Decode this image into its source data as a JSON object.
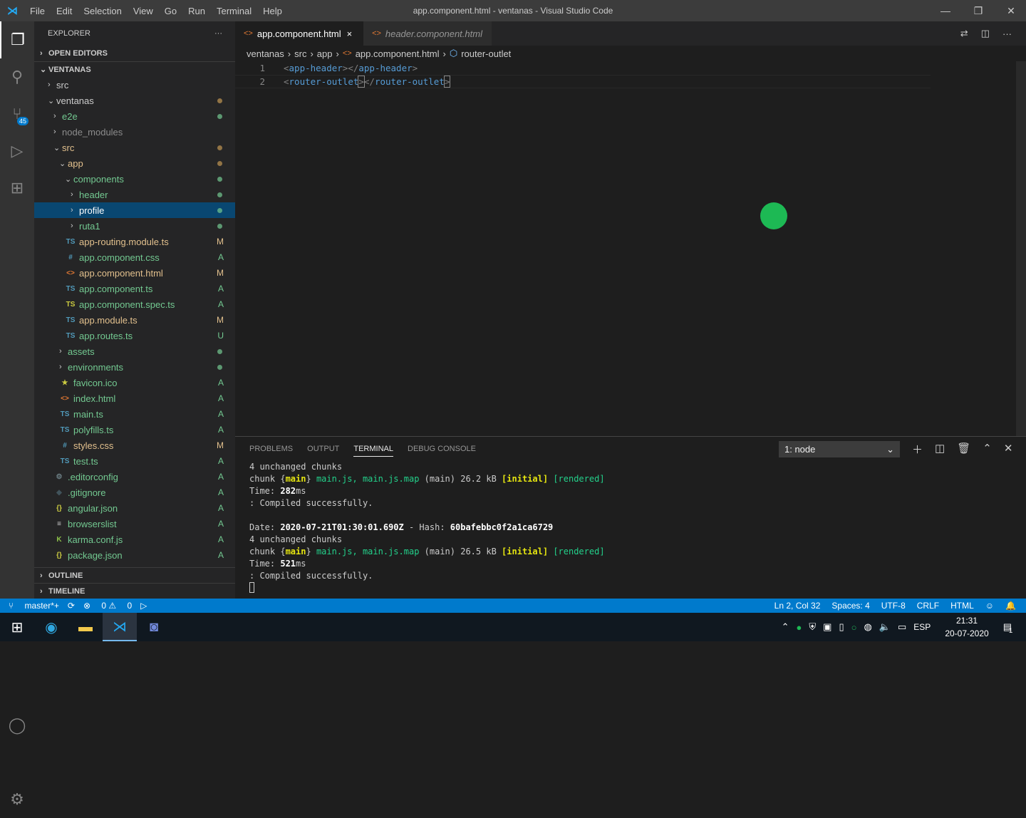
{
  "title_bar": {
    "menu": [
      "File",
      "Edit",
      "Selection",
      "View",
      "Go",
      "Run",
      "Terminal",
      "Help"
    ],
    "title": "app.component.html - ventanas - Visual Studio Code"
  },
  "activity": {
    "scm_badge": "45"
  },
  "sidebar": {
    "title": "EXPLORER",
    "more": "···",
    "open_editors": "OPEN EDITORS",
    "workspace": "VENTANAS",
    "outline": "OUTLINE",
    "timeline": "TIMELINE",
    "tree": [
      {
        "label": "src",
        "indent": 0,
        "type": "closed",
        "color": "#cccccc"
      },
      {
        "label": "ventanas",
        "indent": 0,
        "type": "open",
        "color": "#cccccc",
        "dot": "#c09553"
      },
      {
        "label": "e2e",
        "indent": 1,
        "type": "closed",
        "color": "#73c991",
        "dot": "#73c991"
      },
      {
        "label": "node_modules",
        "indent": 1,
        "type": "closed",
        "color": "#8c8c8c"
      },
      {
        "label": "src",
        "indent": 1,
        "type": "open",
        "color": "#e2c08d",
        "dot": "#c09553"
      },
      {
        "label": "app",
        "indent": 2,
        "type": "open",
        "color": "#e2c08d",
        "dot": "#c09553"
      },
      {
        "label": "components",
        "indent": 3,
        "type": "open",
        "color": "#73c991",
        "dot": "#73c991"
      },
      {
        "label": "header",
        "indent": 4,
        "type": "closed",
        "color": "#73c991",
        "dot": "#73c991"
      },
      {
        "label": "profile",
        "indent": 4,
        "type": "closed",
        "color": "#ffffff",
        "dot": "#73c991",
        "selected": true
      },
      {
        "label": "ruta1",
        "indent": 4,
        "type": "closed",
        "color": "#73c991",
        "dot": "#73c991"
      },
      {
        "label": "app-routing.module.ts",
        "indent": 3,
        "type": "file",
        "icon": "TS",
        "icolor": "#519aba",
        "color": "#e2c08d",
        "deco": "M"
      },
      {
        "label": "app.component.css",
        "indent": 3,
        "type": "file",
        "icon": "#",
        "icolor": "#519aba",
        "color": "#73c991",
        "deco": "A"
      },
      {
        "label": "app.component.html",
        "indent": 3,
        "type": "file",
        "icon": "<>",
        "icolor": "#e37933",
        "color": "#e2c08d",
        "deco": "M"
      },
      {
        "label": "app.component.ts",
        "indent": 3,
        "type": "file",
        "icon": "TS",
        "icolor": "#519aba",
        "color": "#73c991",
        "deco": "A"
      },
      {
        "label": "app.component.spec.ts",
        "indent": 3,
        "type": "file",
        "icon": "TS",
        "icolor": "#cbcb41",
        "color": "#73c991",
        "deco": "A"
      },
      {
        "label": "app.module.ts",
        "indent": 3,
        "type": "file",
        "icon": "TS",
        "icolor": "#519aba",
        "color": "#e2c08d",
        "deco": "M"
      },
      {
        "label": "app.routes.ts",
        "indent": 3,
        "type": "file",
        "icon": "TS",
        "icolor": "#519aba",
        "color": "#73c991",
        "deco": "U"
      },
      {
        "label": "assets",
        "indent": 2,
        "type": "closed",
        "color": "#73c991",
        "dot": "#73c991"
      },
      {
        "label": "environments",
        "indent": 2,
        "type": "closed",
        "color": "#73c991",
        "dot": "#73c991"
      },
      {
        "label": "favicon.ico",
        "indent": 2,
        "type": "file",
        "icon": "★",
        "icolor": "#cbcb41",
        "color": "#73c991",
        "deco": "A"
      },
      {
        "label": "index.html",
        "indent": 2,
        "type": "file",
        "icon": "<>",
        "icolor": "#e37933",
        "color": "#73c991",
        "deco": "A"
      },
      {
        "label": "main.ts",
        "indent": 2,
        "type": "file",
        "icon": "TS",
        "icolor": "#519aba",
        "color": "#73c991",
        "deco": "A"
      },
      {
        "label": "polyfills.ts",
        "indent": 2,
        "type": "file",
        "icon": "TS",
        "icolor": "#519aba",
        "color": "#73c991",
        "deco": "A"
      },
      {
        "label": "styles.css",
        "indent": 2,
        "type": "file",
        "icon": "#",
        "icolor": "#519aba",
        "color": "#e2c08d",
        "deco": "M"
      },
      {
        "label": "test.ts",
        "indent": 2,
        "type": "file",
        "icon": "TS",
        "icolor": "#519aba",
        "color": "#73c991",
        "deco": "A"
      },
      {
        "label": ".editorconfig",
        "indent": 1,
        "type": "file",
        "icon": "⚙",
        "icolor": "#6d8086",
        "color": "#73c991",
        "deco": "A"
      },
      {
        "label": ".gitignore",
        "indent": 1,
        "type": "file",
        "icon": "◆",
        "icolor": "#41535b",
        "color": "#73c991",
        "deco": "A"
      },
      {
        "label": "angular.json",
        "indent": 1,
        "type": "file",
        "icon": "{}",
        "icolor": "#cbcb41",
        "color": "#73c991",
        "deco": "A"
      },
      {
        "label": "browserslist",
        "indent": 1,
        "type": "file",
        "icon": "≡",
        "icolor": "#cccccc",
        "color": "#73c991",
        "deco": "A"
      },
      {
        "label": "karma.conf.js",
        "indent": 1,
        "type": "file",
        "icon": "K",
        "icolor": "#8dc149",
        "color": "#73c991",
        "deco": "A"
      },
      {
        "label": "package.json",
        "indent": 1,
        "type": "file",
        "icon": "{}",
        "icolor": "#cbcb41",
        "color": "#73c991",
        "deco": "A"
      }
    ]
  },
  "tabs": [
    {
      "label": "app.component.html",
      "active": true,
      "close": "×"
    },
    {
      "label": "header.component.html",
      "active": false
    }
  ],
  "breadcrumb": [
    "ventanas",
    "src",
    "app",
    "app.component.html",
    "router-outlet"
  ],
  "code": {
    "lines": [
      {
        "n": "1",
        "open": "app-header",
        "close": "app-header"
      },
      {
        "n": "2",
        "open": "router-outlet",
        "close": "router-outlet"
      }
    ]
  },
  "panel": {
    "tabs": [
      "PROBLEMS",
      "OUTPUT",
      "TERMINAL",
      "DEBUG CONSOLE"
    ],
    "active_tab": "TERMINAL",
    "terminal_select": "1: node",
    "terminal": {
      "l1": "4 unchanged chunks",
      "chunk1_size": "26.2 kB",
      "time1": "282",
      "compiled": ": Compiled successfully.",
      "date": "2020-07-21T01:30:01.690Z",
      "hash": "60bafebbc0f2a1ca6729",
      "chunk2_size": "26.5 kB",
      "time2": "521"
    }
  },
  "status": {
    "branch": "master*+",
    "errors": "0",
    "warnings": "0",
    "position": "Ln 2, Col 32",
    "spaces": "Spaces: 4",
    "encoding": "UTF-8",
    "eol": "CRLF",
    "language": "HTML"
  },
  "taskbar": {
    "lang": "ESP",
    "time": "21:31",
    "date": "20-07-2020",
    "notifications": "1"
  },
  "colors": {
    "accent": "#007acc",
    "cursor_dot": "#1db954"
  }
}
